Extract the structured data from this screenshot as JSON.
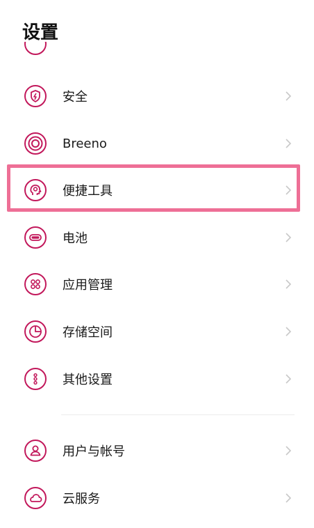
{
  "header": {
    "title": "设置"
  },
  "colors": {
    "accent": "#c2185b",
    "highlight": "#ee6f96",
    "chevron": "#c8c8c8"
  },
  "items": [
    {
      "label": "安全",
      "icon": "shield-lightning-icon"
    },
    {
      "label": "Breeno",
      "icon": "concentric-circles-icon"
    },
    {
      "label": "便捷工具",
      "icon": "head-profile-icon"
    },
    {
      "label": "电池",
      "icon": "battery-icon"
    },
    {
      "label": "应用管理",
      "icon": "app-grid-icon"
    },
    {
      "label": "存储空间",
      "icon": "pie-storage-icon"
    },
    {
      "label": "其他设置",
      "icon": "more-dots-icon"
    },
    {
      "label": "用户与帐号",
      "icon": "user-icon"
    },
    {
      "label": "云服务",
      "icon": "cloud-icon"
    }
  ]
}
